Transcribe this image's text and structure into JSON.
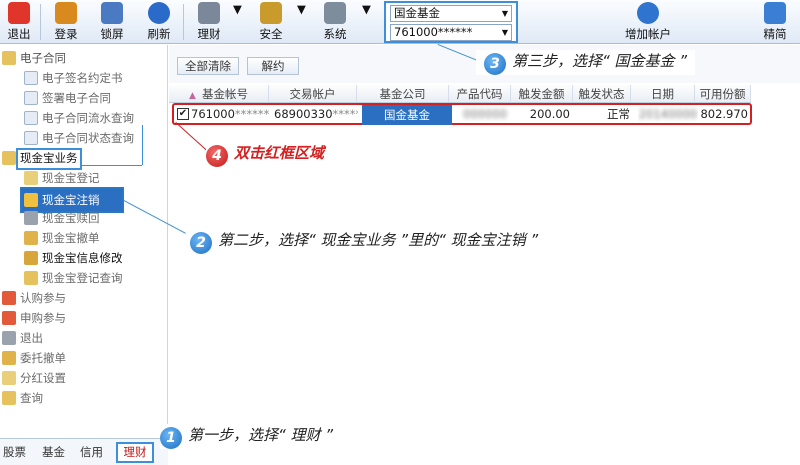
{
  "toolbar": {
    "items": [
      {
        "label": "退出",
        "color": "#e0352b",
        "icon": "power-icon"
      },
      {
        "label": "登录",
        "color": "#d98a1e",
        "icon": "users-icon"
      },
      {
        "label": "锁屏",
        "color": "#4a7bc2",
        "icon": "lock-screen-icon"
      },
      {
        "label": "刷新",
        "color": "#2a6bc9",
        "icon": "refresh-icon"
      },
      {
        "label": "理财",
        "color": "#7a8899",
        "icon": "finance-icon"
      },
      {
        "label": "安全",
        "color": "#c99a2c",
        "icon": "key-icon"
      },
      {
        "label": "系统",
        "color": "#7e8d9c",
        "icon": "tools-icon"
      },
      {
        "label": "增加帐户",
        "color": "#2f74cf",
        "icon": "add-account-icon"
      },
      {
        "label": "精简",
        "color": "#3a7fd4",
        "icon": "simplify-icon"
      }
    ],
    "fund_company_select": "国金基金",
    "account_select": "761000******"
  },
  "left": {
    "tree": [
      {
        "label": "电子合同",
        "level": 0
      },
      {
        "label": "电子签名约定书",
        "level": 1
      },
      {
        "label": "签署电子合同",
        "level": 1
      },
      {
        "label": "电子合同流水查询",
        "level": 1
      },
      {
        "label": "电子合同状态查询",
        "level": 1
      },
      {
        "label": "现金宝业务",
        "level": 0
      },
      {
        "label": "现金宝登记",
        "level": 1
      },
      {
        "label": "现金宝注销",
        "level": 1
      },
      {
        "label": "现金宝赎回",
        "level": 1
      },
      {
        "label": "现金宝撤单",
        "level": 1
      },
      {
        "label": "现金宝信息修改",
        "level": 1
      },
      {
        "label": "现金宝登记查询",
        "level": 1
      },
      {
        "label": "认购参与",
        "level": 0
      },
      {
        "label": "申购参与",
        "level": 0
      },
      {
        "label": "退出",
        "level": 0
      },
      {
        "label": "委托撤单",
        "level": 0
      },
      {
        "label": "分红设置",
        "level": 0
      },
      {
        "label": "查询",
        "level": 0
      }
    ],
    "tabs": [
      "股票",
      "基金",
      "信用",
      "理财"
    ]
  },
  "right": {
    "buttons": [
      "全部清除",
      "解约"
    ],
    "columns": [
      "基金帐号",
      "交易帐户",
      "基金公司",
      "产品代码",
      "触发金额",
      "触发状态",
      "日期",
      "可用份额"
    ],
    "row": {
      "fund_account": "761000",
      "fund_account_mask": "******",
      "trade_account": "68900330",
      "trade_account_mask": "******",
      "company": "国金基金",
      "product_code": "000000",
      "trigger_amount": "200.00",
      "trigger_status": "正常",
      "date": "20140000",
      "available_shares": "802.970"
    }
  },
  "annotations": {
    "step1_num": "1",
    "step1": "第一步，选择“ 理财 ”",
    "step2_num": "2",
    "step2": "第二步，选择“ 现金宝业务 ”里的“ 现金宝注销 ”",
    "step3_num": "3",
    "step3": "第三步，选择“ 国金基金 ”",
    "step4_num": "4",
    "step4": "双击红框区域"
  }
}
